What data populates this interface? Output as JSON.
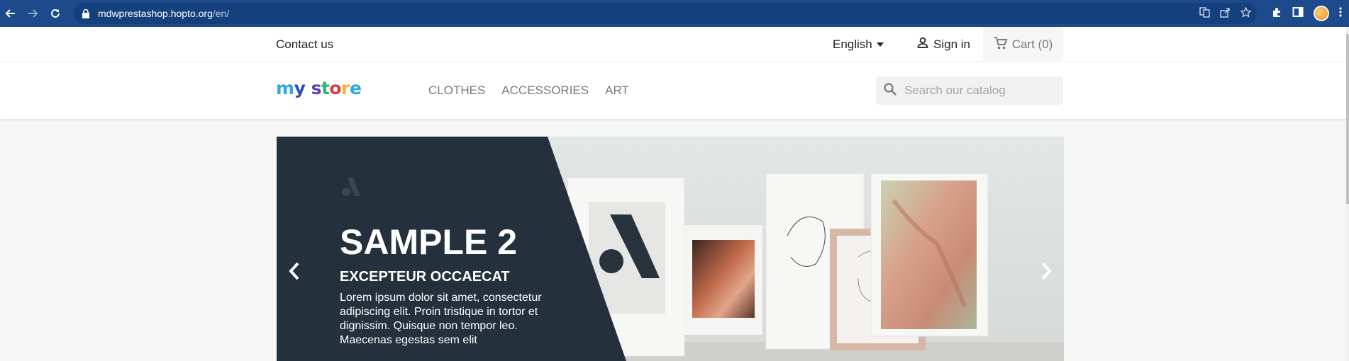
{
  "browser": {
    "url_host": "mdwprestashop.hopto.org",
    "url_path": "/en/"
  },
  "topnav": {
    "contact": "Contact us",
    "language": "English",
    "signin": "Sign in",
    "cart": "Cart (0)"
  },
  "header": {
    "logo": [
      "m",
      "y",
      " ",
      "s",
      "t",
      "o",
      "r",
      "e"
    ],
    "logo_colors": [
      "#2fa8e0",
      "#2b4bb7",
      "#fff",
      "#5b3fb5",
      "#2fb66b",
      "#e03a3e",
      "#f2b233",
      "#2fa8e0"
    ],
    "menu": [
      "CLOTHES",
      "ACCESSORIES",
      "ART"
    ],
    "search_placeholder": "Search our catalog"
  },
  "slide": {
    "title": "SAMPLE 2",
    "subtitle": "EXCEPTEUR OCCAECAT",
    "text": "Lorem ipsum dolor sit amet, consectetur adipiscing elit. Proin tristique in tortor et dignissim. Quisque non tempor leo. Maecenas egestas sem elit"
  },
  "colors": {
    "chrome": "#1c4a8a",
    "panel": "#24313c",
    "text_dark": "#232323",
    "text_muted": "#7a7a7a"
  }
}
